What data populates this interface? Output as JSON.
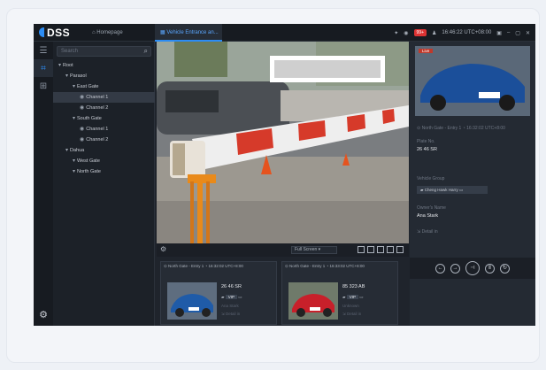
{
  "app": {
    "logo": "DSS",
    "home_tab": "Homepage",
    "live_tab": "Vehicle Entrance an...",
    "alarm_count": "99+",
    "time": "16:46:22 UTC+08:00"
  },
  "rail": {
    "settings_icon": "gear-icon"
  },
  "tree": {
    "search_placeholder": "Search",
    "nodes": [
      {
        "label": "Root",
        "indent": 0
      },
      {
        "label": "Parasol",
        "indent": 1
      },
      {
        "label": "East Gate",
        "indent": 2
      },
      {
        "label": "Channel 1",
        "indent": 3,
        "selected": true
      },
      {
        "label": "Channel 2",
        "indent": 3
      },
      {
        "label": "South Gate",
        "indent": 2
      },
      {
        "label": "Channel 1",
        "indent": 3
      },
      {
        "label": "Channel 2",
        "indent": 3
      },
      {
        "label": "Dahua",
        "indent": 1
      },
      {
        "label": "West Gate",
        "indent": 2
      },
      {
        "label": "North Gate",
        "indent": 2
      }
    ]
  },
  "video": {
    "screen_mode": "Full Screen"
  },
  "events": [
    {
      "channel": "North Gate - Entry 1",
      "time": "16:32:02 UTC+8:00",
      "plate": "26 46 SR",
      "list": "VIP",
      "owner": "Ana Stark",
      "detail": "Detail in"
    },
    {
      "channel": "North Gate - Entry 1",
      "time": "16:33:02 UTC+8:00",
      "plate": "85 323 AB",
      "list": "VIP",
      "owner": "Unknown",
      "detail": "Detail in"
    }
  ],
  "right": {
    "stamp": "Live",
    "channel": "North Gate - Entry 1",
    "time": "16:32:02 UTC+8:00",
    "plate_label": "Plate No.",
    "plate_value": "26 46 SR",
    "group_label": "Vehicle Group",
    "group_value": "Cheng Hawk Harry",
    "owner_label": "Owner's Name",
    "owner_value": "Ana Stark",
    "detail_link": "Detail in"
  }
}
